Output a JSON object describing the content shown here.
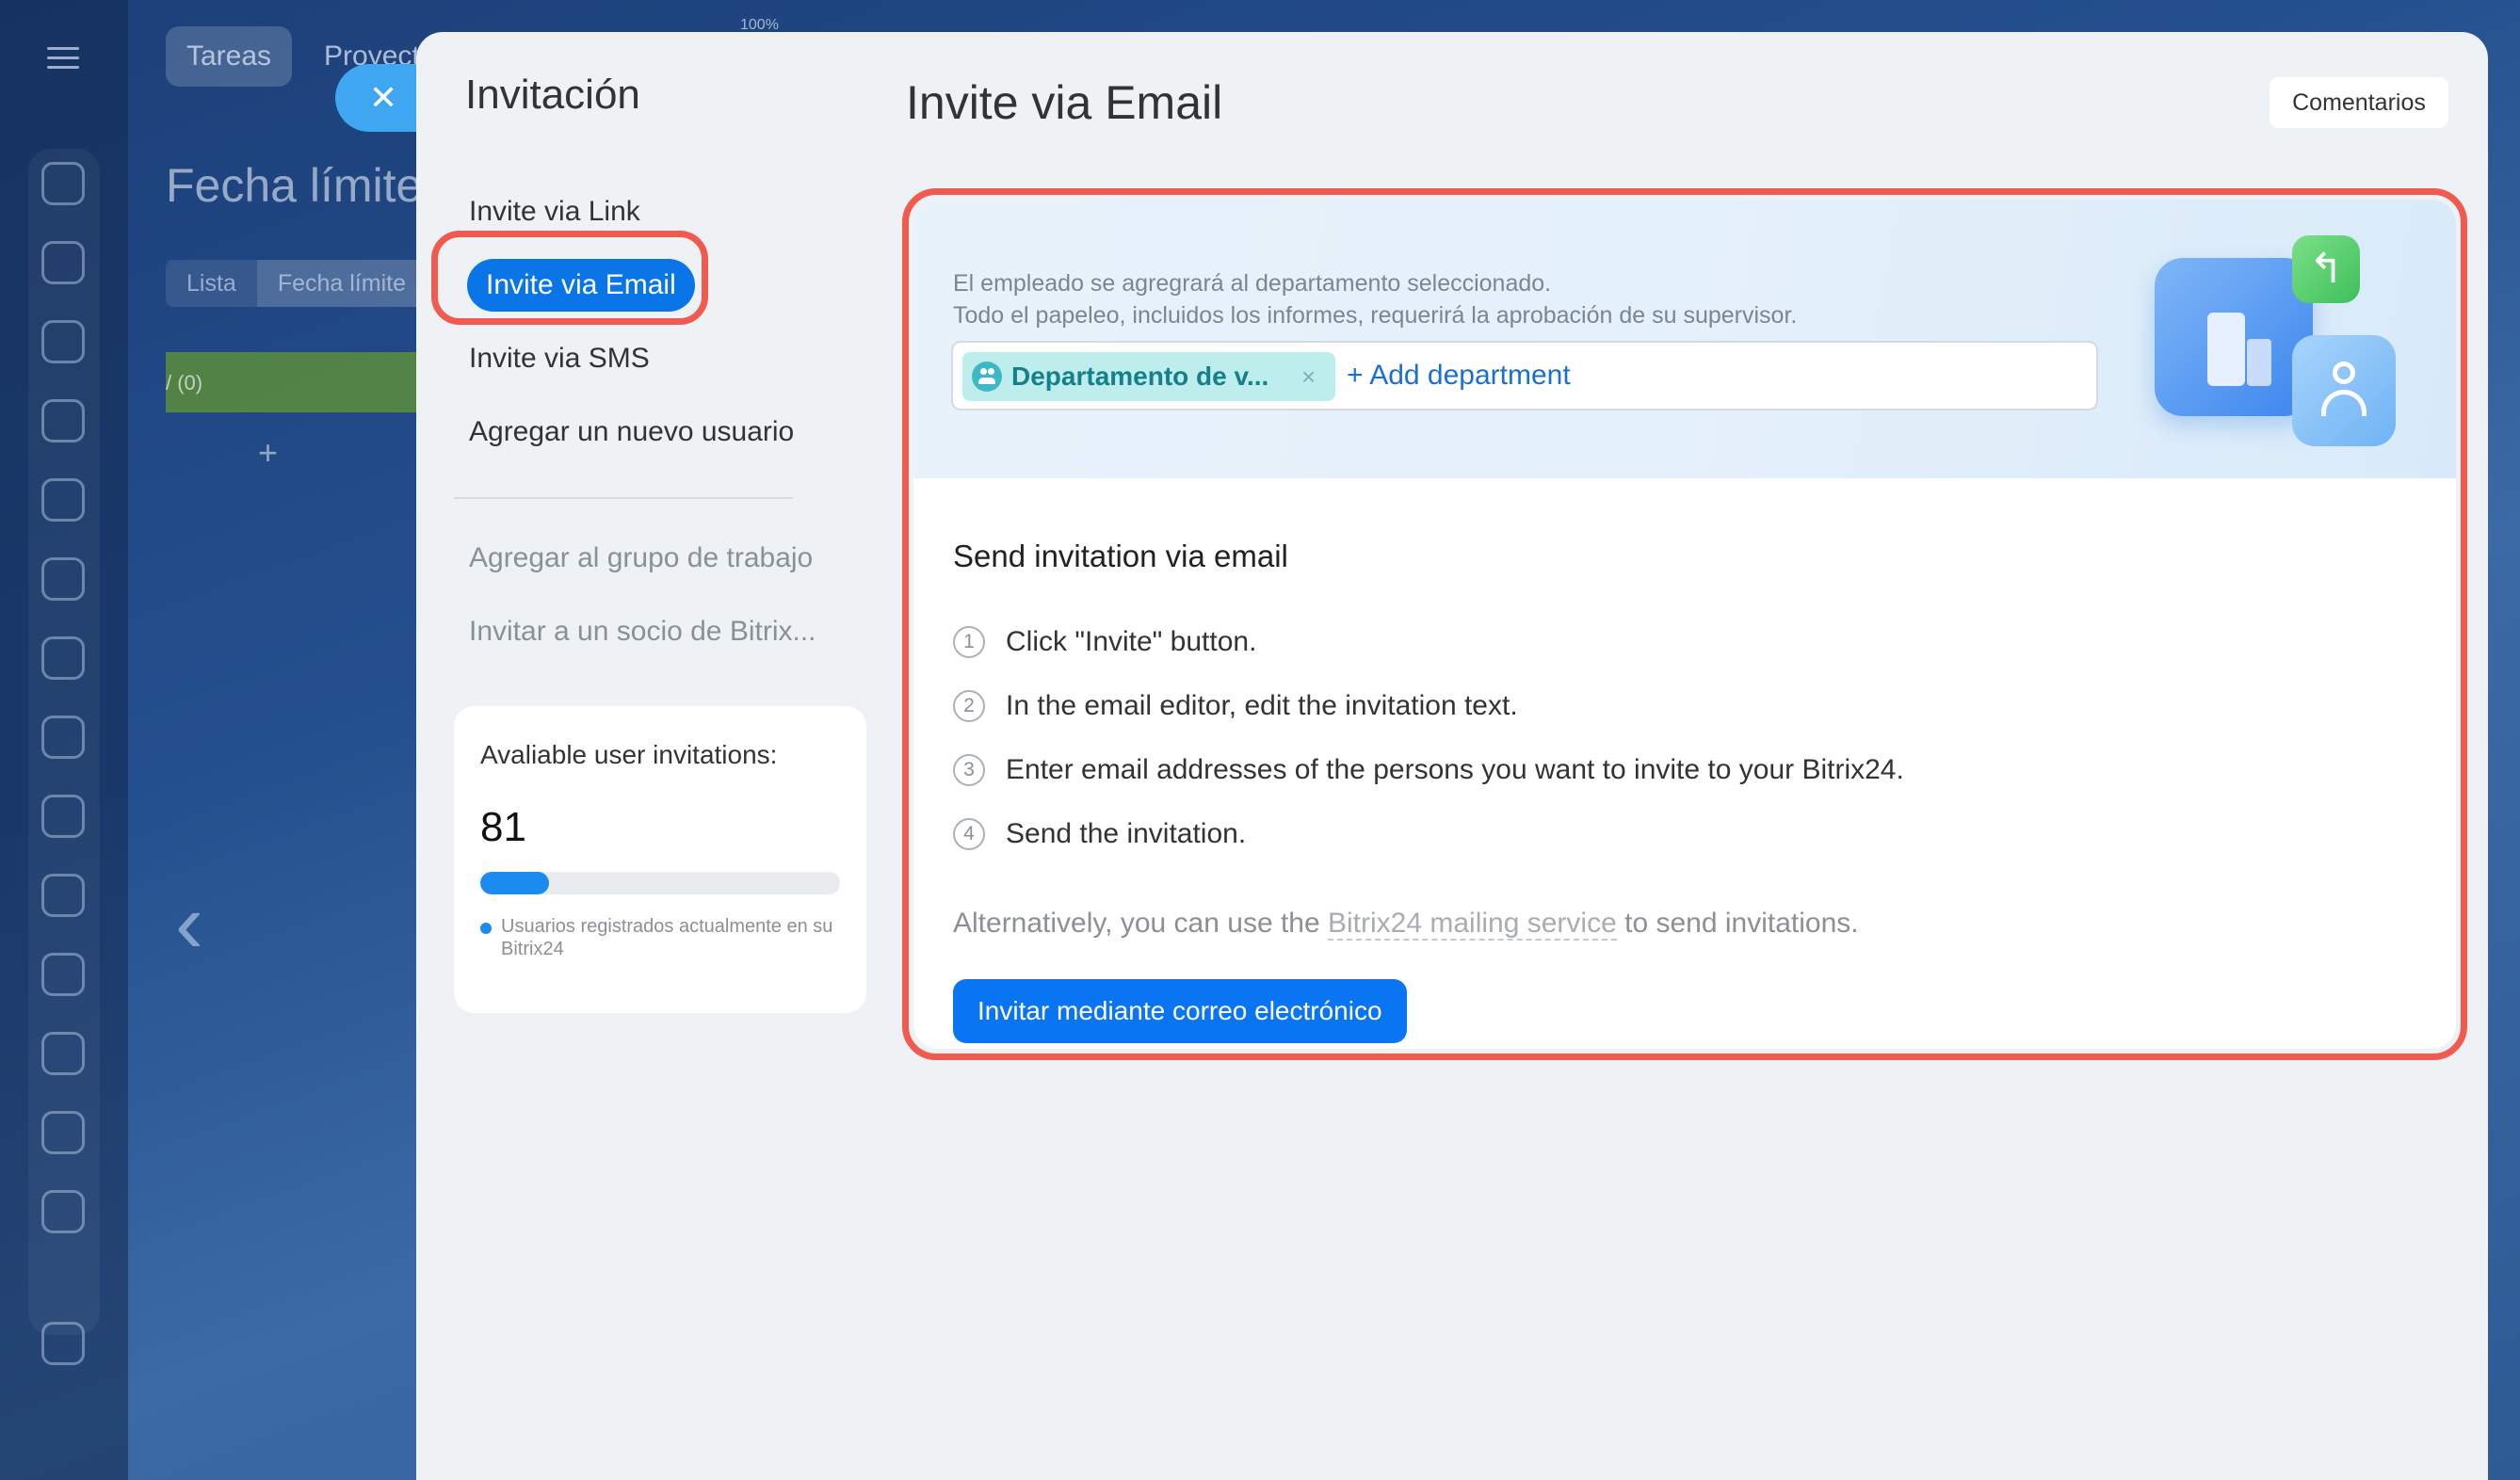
{
  "background": {
    "tabs": [
      "Tareas",
      "Proyect"
    ],
    "zoom": "100%",
    "title": "Fecha límite",
    "views": [
      "Lista",
      "Fecha límite"
    ],
    "column_label": "/ (0)",
    "add_symbol": "+",
    "back_symbol": "‹"
  },
  "close_symbol": "✕",
  "nav": {
    "title": "Invitación",
    "items": [
      {
        "label": "Invite via Link"
      },
      {
        "label": "Invite via Email",
        "active": true
      },
      {
        "label": "Invite via SMS"
      },
      {
        "label": "Agregar un nuevo usuario"
      }
    ],
    "secondary": [
      {
        "label": "Agregar al grupo de trabajo"
      },
      {
        "label": "Invitar a un socio de Bitrix..."
      }
    ]
  },
  "invitations": {
    "label": "Avaliable user invitations:",
    "count": "81",
    "fill_fraction": 0.19,
    "legend": "Usuarios registrados actualmente en su Bitrix24"
  },
  "page_title": "Invite via Email",
  "comments_label": "Comentarios",
  "department": {
    "hint_line1": "El empleado se agregrará al departamento seleccionado.",
    "hint_line2": "Todo el papeleo, incluidos los informes, requerirá la aprobación de su supervisor.",
    "tag_label": "Departamento de v...",
    "tag_remove": "×",
    "add_label": "+ Add department"
  },
  "steps": {
    "title": "Send invitation via email",
    "items": [
      {
        "num": "1",
        "text": "Click \"Invite\" button."
      },
      {
        "num": "2",
        "text": "In the email editor, edit the invitation text."
      },
      {
        "num": "3",
        "text": "Enter email addresses of the persons you want to invite to your Bitrix24."
      },
      {
        "num": "4",
        "text": "Send the invitation."
      }
    ],
    "alt_prefix": "Alternatively, you can use the ",
    "alt_link": "Bitrix24 mailing service",
    "alt_suffix": " to send invitations."
  },
  "invite_button": "Invitar mediante correo electrónico",
  "colors": {
    "accent": "#0a75f2",
    "highlight": "#f05a4f",
    "tag_bg": "#bdeeed"
  }
}
